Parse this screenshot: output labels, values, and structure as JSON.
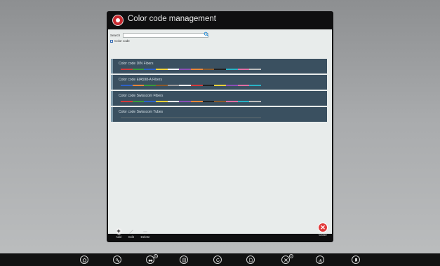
{
  "dialog": {
    "title": "Color code management",
    "search_label": "Search",
    "search_value": "",
    "search_placeholder": "",
    "checkbox_label": "Color code",
    "items": [
      {
        "label": "Color code DIN Fibers",
        "colors": [
          "#d23a3a",
          "#3a9a3a",
          "#2d62c8",
          "#f2d23a",
          "#ffffff",
          "#8a4fb5",
          "#e8863a",
          "#8b5a2b",
          "#222222",
          "#29b3c6",
          "#e06fa4",
          "#bfbfbf"
        ]
      },
      {
        "label": "Color code EIA598-A Fibers",
        "colors": [
          "#2d62c8",
          "#e8863a",
          "#3a9a3a",
          "#8b5a2b",
          "#9a9a9a",
          "#ffffff",
          "#d23a3a",
          "#222222",
          "#f2d23a",
          "#8a4fb5",
          "#e06fa4",
          "#29b3c6"
        ]
      },
      {
        "label": "Color code Swisscom Fibers",
        "colors": [
          "#d23a3a",
          "#3a9a3a",
          "#2d62c8",
          "#f2d23a",
          "#ffffff",
          "#8a4fb5",
          "#e8863a",
          "#222222",
          "#8b5a2b",
          "#e06fa4",
          "#29b3c6",
          "#bfbfbf"
        ]
      },
      {
        "label": "Color code Swisscom Tubes",
        "colors": [
          "#4e5e68",
          "#4e5e68",
          "#4e5e68",
          "#4e5e68",
          "#4e5e68",
          "#4e5e68",
          "#4e5e68",
          "#4e5e68",
          "#4e5e68",
          "#4e5e68",
          "#4e5e68",
          "#4e5e68"
        ]
      }
    ],
    "toolbar": {
      "add_label": "Add",
      "edit_label": "Edit",
      "delete_label": "Delete",
      "close_label": "Close"
    }
  },
  "taskbar": {
    "icons": [
      "home-icon",
      "settings-icon",
      "binoculars-icon",
      "document-icon",
      "refresh-icon",
      "file-icon",
      "tools-icon",
      "chart-icon",
      "bookmark-icon"
    ],
    "badges": {
      "binoculars": "①",
      "tools": "①"
    }
  },
  "colors": {
    "list_bg": "#3a5060",
    "close_red": "#e23b3b",
    "taskbar_bg": "#121212"
  }
}
